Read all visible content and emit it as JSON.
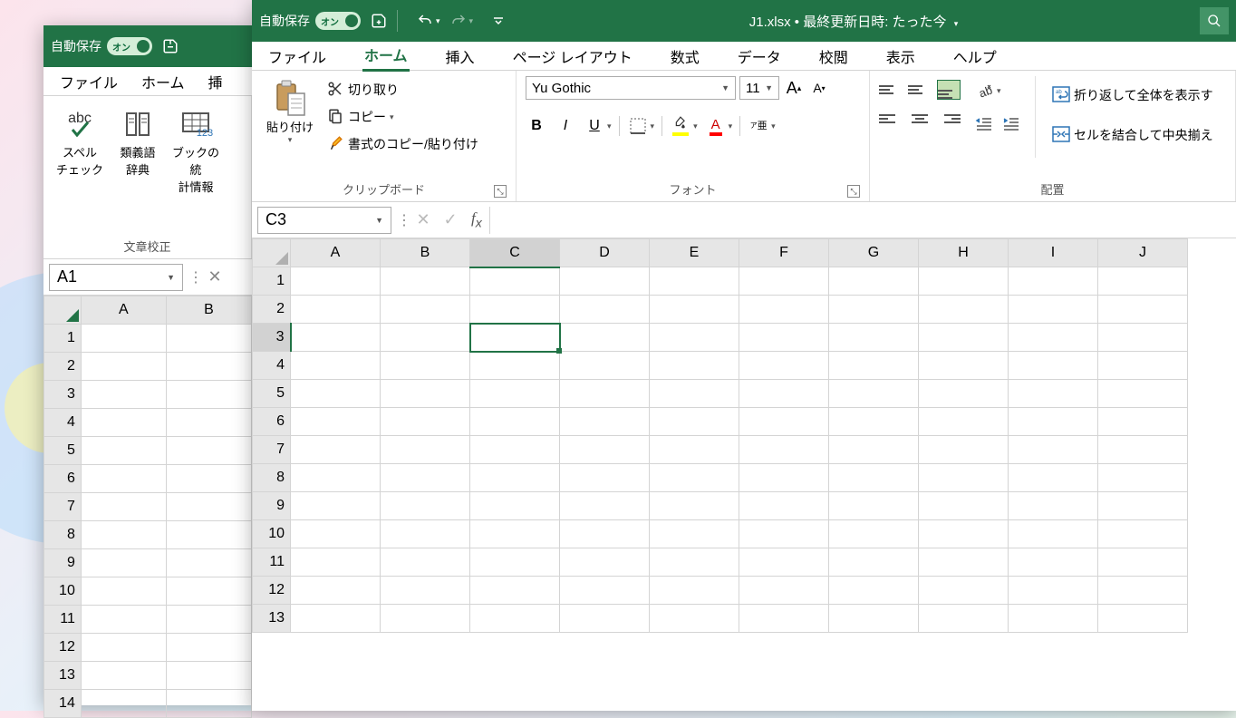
{
  "back_window": {
    "autosave_label": "自動保存",
    "autosave_toggle": "オン",
    "tabs": [
      "ファイル",
      "ホーム",
      "挿"
    ],
    "group1": {
      "btn1": {
        "label_l1": "スペル",
        "label_l2": "チェック"
      },
      "btn2": {
        "label_l1": "類義語",
        "label_l2": "辞典"
      },
      "btn3": {
        "label_l1": "ブックの統",
        "label_l2": "計情報"
      },
      "group_label": "文章校正"
    },
    "namebox": "A1",
    "columns": [
      "A",
      "B"
    ],
    "rows": [
      "1",
      "2",
      "3",
      "4",
      "5",
      "6",
      "7",
      "8",
      "9",
      "10",
      "11",
      "12",
      "13",
      "14"
    ]
  },
  "front_window": {
    "autosave_label": "自動保存",
    "autosave_toggle": "オン",
    "title": "J1.xlsx • 最終更新日時: たった今",
    "tabs": [
      "ファイル",
      "ホーム",
      "挿入",
      "ページ レイアウト",
      "数式",
      "データ",
      "校閲",
      "表示",
      "ヘルプ"
    ],
    "active_tab": "ホーム",
    "clipboard": {
      "paste": "貼り付け",
      "cut": "切り取り",
      "copy": "コピー",
      "format_painter": "書式のコピー/貼り付け",
      "group_label": "クリップボード"
    },
    "font": {
      "name": "Yu Gothic",
      "size": "11",
      "group_label": "フォント"
    },
    "alignment": {
      "wrap": "折り返して全体を表示す",
      "merge": "セルを結合して中央揃え",
      "group_label": "配置"
    },
    "namebox": "C3",
    "columns": [
      "A",
      "B",
      "C",
      "D",
      "E",
      "F",
      "G",
      "H",
      "I",
      "J"
    ],
    "rows": [
      "1",
      "2",
      "3",
      "4",
      "5",
      "6",
      "7",
      "8",
      "9",
      "10",
      "11",
      "12",
      "13"
    ],
    "selected_col": "C",
    "selected_row": "3"
  }
}
